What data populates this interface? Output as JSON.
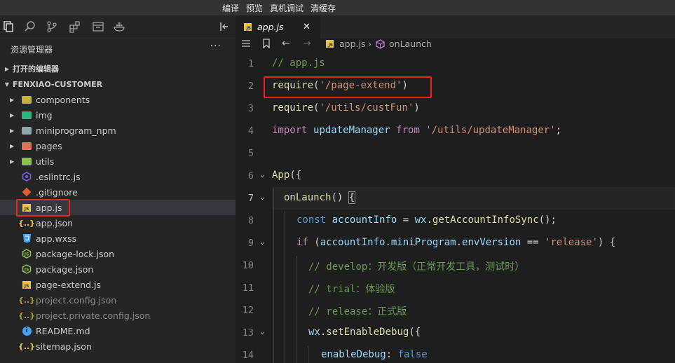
{
  "menu": [
    "编译",
    "预览",
    "真机调试",
    "清缓存"
  ],
  "toolbar_icons": [
    "files-icon",
    "search-icon",
    "source-control-icon",
    "extensions-icon",
    "devtools-icon",
    "docker-icon"
  ],
  "sidebar": {
    "title": "资源管理器",
    "more": "···",
    "open_editors": "打开的编辑器",
    "project": "FENXIAO-CUSTOMER",
    "items": [
      {
        "name": "components",
        "type": "folder",
        "color": "#c6b43a"
      },
      {
        "name": "img",
        "type": "folder",
        "color": "#2ab57d"
      },
      {
        "name": "miniprogram_npm",
        "type": "folder",
        "color": "#90a4ae"
      },
      {
        "name": "pages",
        "type": "folder",
        "color": "#e2725b"
      },
      {
        "name": "utils",
        "type": "folder",
        "color": "#8bc34a"
      },
      {
        "name": ".eslintrc.js",
        "type": "eslint",
        "color": "#4b32c3"
      },
      {
        "name": ".gitignore",
        "type": "git",
        "color": "#e05d30"
      },
      {
        "name": "app.js",
        "type": "js",
        "color": "#e8c547"
      },
      {
        "name": "app.json",
        "type": "json",
        "color": "#e8c547"
      },
      {
        "name": "app.wxss",
        "type": "css",
        "color": "#42a5f5"
      },
      {
        "name": "package-lock.json",
        "type": "npm",
        "color": "#8bc34a"
      },
      {
        "name": "package.json",
        "type": "npm",
        "color": "#8bc34a"
      },
      {
        "name": "page-extend.js",
        "type": "js",
        "color": "#e8c547"
      },
      {
        "name": "project.config.json",
        "type": "json",
        "color": "#e8c547"
      },
      {
        "name": "project.private.config.json",
        "type": "json",
        "color": "#e8c547"
      },
      {
        "name": "README.md",
        "type": "info",
        "color": "#42a5f5"
      },
      {
        "name": "sitemap.json",
        "type": "json",
        "color": "#e8c547"
      }
    ]
  },
  "tab": {
    "label": "app.js",
    "badge": "JS",
    "close": "✕"
  },
  "breadcrumb": {
    "file": "app.js",
    "sep": "›",
    "symbol": "onLaunch"
  },
  "code_lines": [
    {
      "n": "1",
      "t": "// app.js"
    },
    {
      "n": "2",
      "t": "require('/page-extend')"
    },
    {
      "n": "3",
      "t": "require('/utils/custFun')"
    },
    {
      "n": "4",
      "t": "import updateManager from '/utils/updateManager';"
    },
    {
      "n": "5",
      "t": ""
    },
    {
      "n": "6",
      "t": "App({"
    },
    {
      "n": "7",
      "t": "onLaunch() {"
    },
    {
      "n": "8",
      "t": "const accountInfo = wx.getAccountInfoSync();"
    },
    {
      "n": "9",
      "t": "if (accountInfo.miniProgram.envVersion == 'release') {"
    },
    {
      "n": "10",
      "t": "// develop：开发版（正常开发工具，测试时）"
    },
    {
      "n": "11",
      "t": "// trial：体验版"
    },
    {
      "n": "12",
      "t": "// release：正式版"
    },
    {
      "n": "13",
      "t": "wx.setEnableDebug({"
    },
    {
      "n": "14",
      "t": "enableDebug: false"
    }
  ],
  "tokens": {
    "l1": "// app.js",
    "require": "require",
    "p2": "('/page-extend')",
    "s2": "'/page-extend'",
    "s3": "'/utils/custFun'",
    "import": "import",
    "updateManager": "updateManager",
    "from": "from",
    "s4": "'/utils/updateManager'",
    "semi": ";",
    "App": "App",
    "onLaunch": "onLaunch",
    "const": "const",
    "accountInfo": "accountInfo",
    "wx": "wx",
    "getAccountInfoSync": "getAccountInfoSync",
    "if": "if",
    "miniProgram": "miniProgram",
    "envVersion": "envVersion",
    "release": "'release'",
    "c10": "// develop：开发版（正常开发工具，测试时）",
    "c11": "// trial：体验版",
    "c12": "// release：正式版",
    "setEnableDebug": "setEnableDebug",
    "enableDebug": "enableDebug",
    "false": "false"
  }
}
